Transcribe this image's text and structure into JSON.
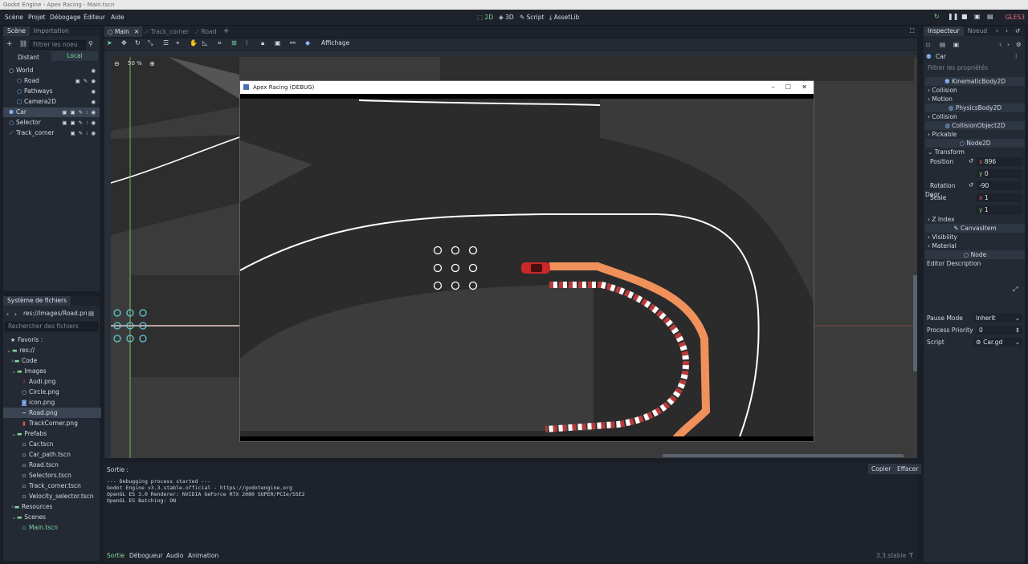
{
  "window": {
    "title": "Godot Engine - Apex Racing - Main.tscn"
  },
  "menu": [
    "Scène",
    "Projet",
    "Débogage",
    "Éditeur",
    "Aide"
  ],
  "modes": {
    "m2d": "2D",
    "m3d": "3D",
    "script": "Script",
    "assetlib": "AssetLib"
  },
  "renderer": "GLES3",
  "scene_dock": {
    "tabs": [
      "Scène",
      "Importation"
    ],
    "filter_placeholder": "Filtrer les noeu",
    "distant": "Distant",
    "local": "Local",
    "nodes": [
      "World",
      "Road",
      "Pathways",
      "Camera2D",
      "Car",
      "Selector",
      "Track_corner"
    ]
  },
  "editor_tabs": [
    "Main",
    "Track_corner",
    "Road"
  ],
  "toolbar": {
    "view_label": "Affichage"
  },
  "zoom": "50 %",
  "filesystem": {
    "title": "Système de fichiers",
    "path": "res://Images/Road.pn",
    "search_placeholder": "Rechercher des fichiers",
    "items": [
      "Favoris :",
      "res://",
      "Code",
      "Images",
      "Audi.png",
      "Circle.png",
      "icon.png",
      "Road.png",
      "TrackCorner.png",
      "Prefabs",
      "Car.tscn",
      "Car_path.tscn",
      "Road.tscn",
      "Selectors.tscn",
      "Track_corner.tscn",
      "Velocity_selector.tscn",
      "Resources",
      "Scenes",
      "Main.tscn"
    ]
  },
  "debug_window": {
    "title": "Apex Racing (DEBUG)"
  },
  "output": {
    "label": "Sortie :",
    "copy": "Copier",
    "clear": "Effacer",
    "lines": [
      "--- Debugging process started ---",
      "Godot Engine v3.3.stable.official - https://godotengine.org",
      "OpenGL ES 3.0 Renderer: NVIDIA GeForce RTX 2080 SUPER/PCIe/SSE2",
      "OpenGL ES Batching: ON"
    ]
  },
  "bottom_tabs": [
    "Sortie",
    "Débogueur",
    "Audio",
    "Animation"
  ],
  "version": "3.3.stable",
  "inspector": {
    "tabs": [
      "Inspecteur",
      "Noeud"
    ],
    "node": "Car",
    "filter_placeholder": "Filtrer les propriétés",
    "rows": {
      "kb": "KinematicBody2D",
      "collision1": "Collision",
      "motion": "Motion",
      "pb": "PhysicsBody2D",
      "collision2": "Collision",
      "co": "CollisionObject2D",
      "pickable": "Pickable",
      "n2d": "Node2D",
      "transform": "Transform",
      "position": "Position",
      "rotation": "Rotation Degr",
      "scale": "Scale",
      "zindex": "Z Index",
      "canvas": "CanvasItem",
      "visibility": "Visibility",
      "material": "Material",
      "node": "Node",
      "desc": "Editor Description",
      "pause": "Pause Mode",
      "priority": "Process Priority",
      "script": "Script"
    },
    "values": {
      "pos_x": "896",
      "pos_y": "0",
      "rot": "-90",
      "scale_x": "1",
      "scale_y": "1",
      "pause": "Inherit",
      "priority": "0",
      "script": "Car.gd",
      "lx": "x",
      "ly": "y"
    }
  },
  "colors": {
    "accent": "#7fd8a0",
    "bg": "#232a34",
    "kerb_orange": "#f0905a",
    "kerb_red": "#b83a3a"
  }
}
